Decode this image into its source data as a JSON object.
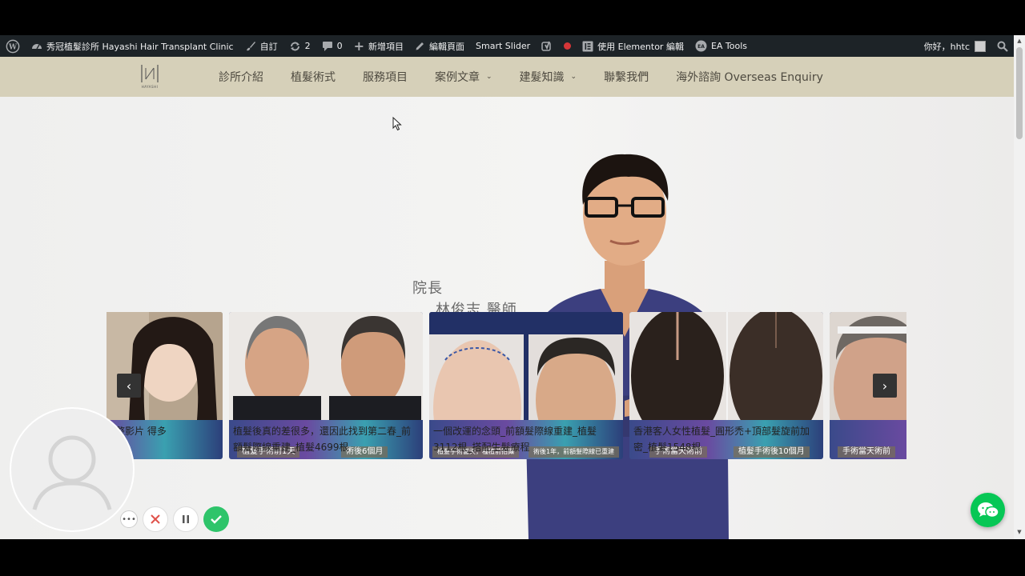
{
  "admin_bar": {
    "site_name": "秀冠植髮診所 Hayashi Hair Transplant Clinic",
    "customize": "自訂",
    "updates_count": "2",
    "comments_count": "0",
    "new_item": "新增項目",
    "edit_page": "編輯頁面",
    "smart_slider": "Smart Slider",
    "elementor_edit": "使用 Elementor 編輯",
    "ea_tools": "EA Tools",
    "greeting": "你好，hhtc"
  },
  "header": {
    "logo_sub": "HAYASHI",
    "nav": [
      {
        "label": "診所介紹",
        "has_dropdown": false
      },
      {
        "label": "植髮術式",
        "has_dropdown": false
      },
      {
        "label": "服務項目",
        "has_dropdown": false
      },
      {
        "label": "案例文章",
        "has_dropdown": true
      },
      {
        "label": "建髮知識",
        "has_dropdown": true
      },
      {
        "label": "聯繫我們",
        "has_dropdown": false
      },
      {
        "label": "海外諮詢 Overseas Enquiry",
        "has_dropdown": false
      }
    ]
  },
  "hero": {
    "title": "院長",
    "name": "林俊志 醫師"
  },
  "slider": {
    "cards": [
      {
        "text": "例_手術前後完整影片 得多",
        "tags": []
      },
      {
        "text": "植髮後真的差很多，還因此找到第二春_前額髮際線重建_植髮4699根",
        "tags": [
          "植髮手術前1天",
          "術後6個月"
        ]
      },
      {
        "text": "一個改運的念頭_前額髮際線重建_植髮3112根_搭配生髮療程",
        "tags": [
          "植髮手術當天，種植前拍攝",
          "術後1年，前額髮際線已重建"
        ]
      },
      {
        "text": "香港客人女性植髮_圓形禿+頂部髮旋前加密_植髮1548根",
        "tags": [
          "手術當天術前",
          "植髮手術後10個月"
        ]
      },
      {
        "text": "",
        "tags": [
          "手術當天術前"
        ]
      }
    ],
    "prev": "‹",
    "next": "›"
  },
  "colors": {
    "admin_bar": "#1d2327",
    "header_bg": "#d6d0b9",
    "nav_text": "#4e4a40",
    "chat_green": "#06c755"
  }
}
